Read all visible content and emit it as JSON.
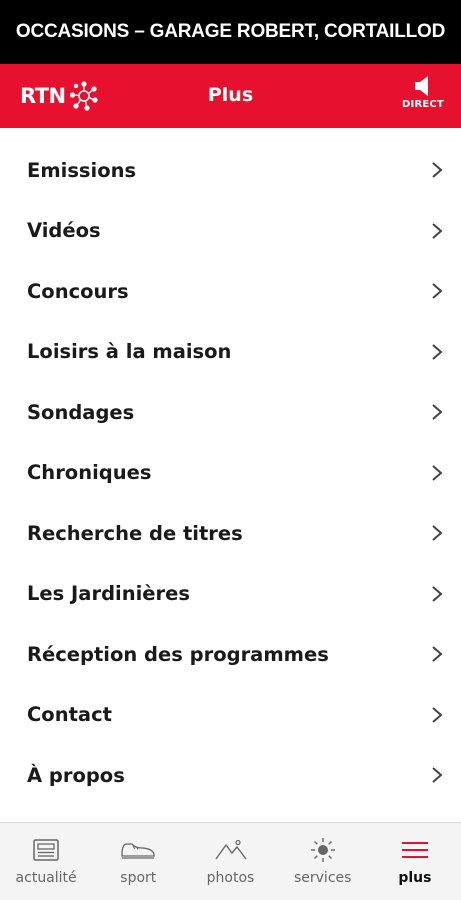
{
  "ad_banner": {
    "text": "OCCASIONS – GARAGE ROBERT, CORTAILLOD"
  },
  "header": {
    "logo_text": "RTN",
    "title": "Plus",
    "direct_label": "DIRECT",
    "background_color": "#e8102f"
  },
  "menu": {
    "items": [
      {
        "label": "Emissions"
      },
      {
        "label": "Vidéos"
      },
      {
        "label": "Concours"
      },
      {
        "label": "Loisirs à la maison"
      },
      {
        "label": "Sondages"
      },
      {
        "label": "Chroniques"
      },
      {
        "label": "Recherche de titres"
      },
      {
        "label": "Les Jardinières"
      },
      {
        "label": "Réception des programmes"
      },
      {
        "label": "Contact"
      },
      {
        "label": "À propos"
      }
    ]
  },
  "tabbar": {
    "tabs": [
      {
        "label": "actualité",
        "icon": "newspaper-icon"
      },
      {
        "label": "sport",
        "icon": "sneaker-icon"
      },
      {
        "label": "photos",
        "icon": "mountain-icon"
      },
      {
        "label": "services",
        "icon": "sun-icon"
      },
      {
        "label": "plus",
        "icon": "hamburger-menu-icon",
        "active": true
      }
    ],
    "active_color": "#e8102f"
  }
}
